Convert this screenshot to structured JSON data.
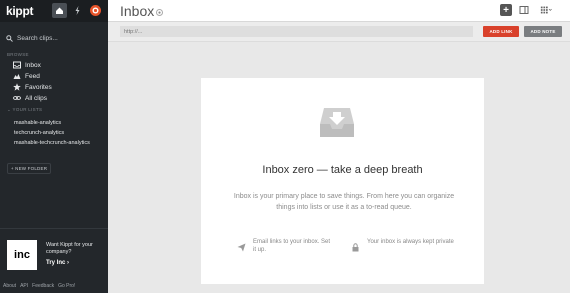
{
  "app": {
    "logo": "kippt"
  },
  "sidebar": {
    "search_placeholder": "Search clips...",
    "browse_label": "BROWSE",
    "nav": [
      {
        "label": "Inbox",
        "icon": "inbox-icon"
      },
      {
        "label": "Feed",
        "icon": "feed-icon"
      },
      {
        "label": "Favorites",
        "icon": "star-icon"
      },
      {
        "label": "All clips",
        "icon": "link-icon"
      }
    ],
    "lists_label": "YOUR LISTS",
    "lists": [
      "mashable-analytics",
      "techcrunch-analytics",
      "mashable-techcrunch-analytics"
    ],
    "new_folder_label": "+ NEW FOLDER",
    "promo": {
      "logo_text": "inc",
      "text": "Want Kippt for your company?",
      "cta": "Try Inc ›"
    },
    "footer": [
      "About",
      "API",
      "Feedback",
      "Go Pro!"
    ]
  },
  "header": {
    "title": "Inbox"
  },
  "add_bar": {
    "url_placeholder": "http://...",
    "add_link_label": "ADD LINK",
    "add_note_label": "ADD NOTE"
  },
  "empty_state": {
    "title": "Inbox zero — take a deep breath",
    "description": "Inbox is your primary place to save things. From here you can organize things into lists or use it as a to-read queue.",
    "feature_email": "Email links to your inbox. Set it up.",
    "feature_private": "Your inbox is always kept private"
  },
  "colors": {
    "sidebar_bg": "#23272b",
    "accent_red": "#d9412b",
    "note_gray": "#7a7d80"
  }
}
